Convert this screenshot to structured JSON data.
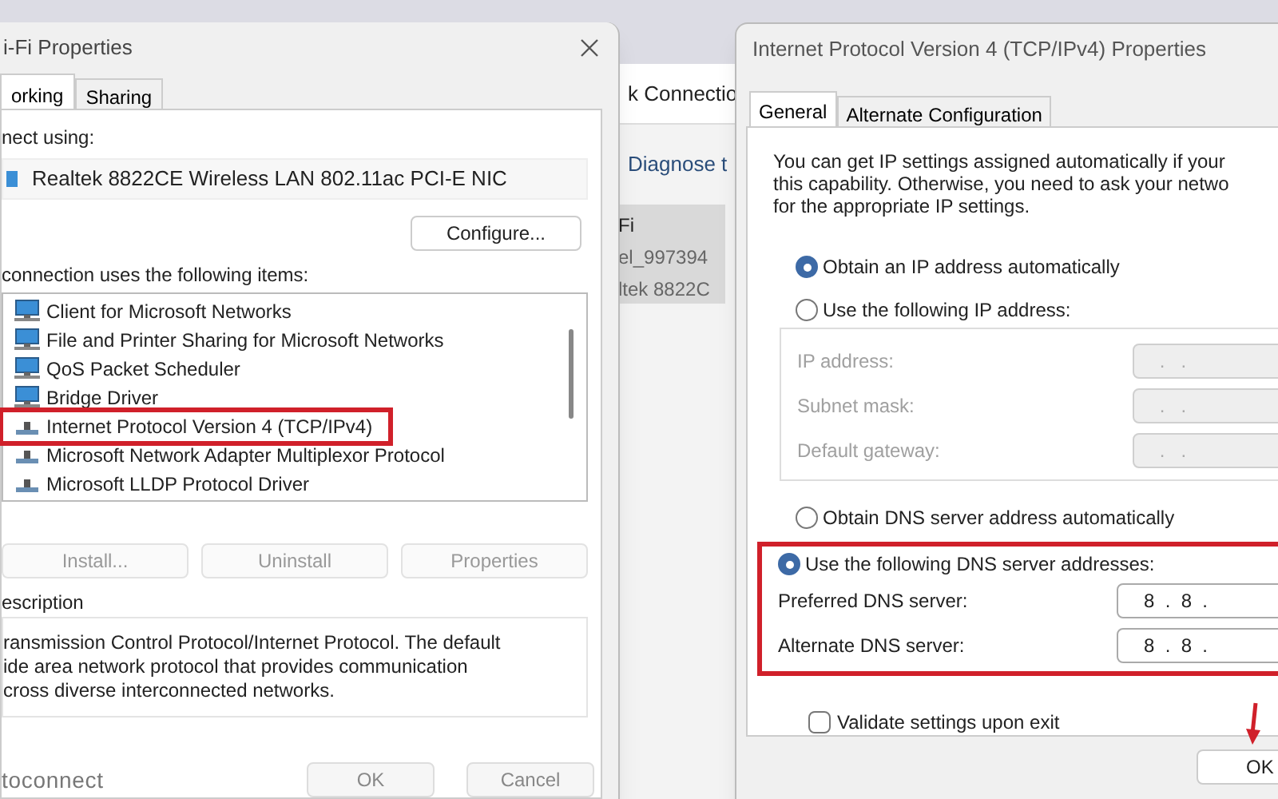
{
  "left_dialog": {
    "title": "i-Fi Properties",
    "tabs": [
      {
        "label": "orking",
        "selected": true
      },
      {
        "label": "Sharing",
        "selected": false
      }
    ],
    "connect_using_label": "nect using:",
    "adapter": "Realtek 8822CE Wireless LAN 802.11ac PCI-E NIC",
    "configure_button": "Configure...",
    "items_label": "connection uses the following items:",
    "items": [
      {
        "kind": "client",
        "label": "Client for Microsoft Networks",
        "highlighted": false
      },
      {
        "kind": "client",
        "label": "File and Printer Sharing for Microsoft Networks",
        "highlighted": false
      },
      {
        "kind": "client",
        "label": "QoS Packet Scheduler",
        "highlighted": false
      },
      {
        "kind": "client",
        "label": "Bridge Driver",
        "highlighted": false
      },
      {
        "kind": "protocol",
        "label": "Internet Protocol Version 4 (TCP/IPv4)",
        "highlighted": true
      },
      {
        "kind": "protocol",
        "label": "Microsoft Network Adapter Multiplexor Protocol",
        "highlighted": false
      },
      {
        "kind": "protocol",
        "label": "Microsoft LLDP Protocol Driver",
        "highlighted": false
      }
    ],
    "buttons": [
      {
        "label": "Install...",
        "disabled": true
      },
      {
        "label": "Uninstall",
        "disabled": true
      },
      {
        "label": "Properties",
        "disabled": true
      }
    ],
    "description_label": "escription",
    "description_lines": [
      "ransmission Control Protocol/Internet Protocol. The default",
      "ide area network protocol that provides communication",
      "cross diverse interconnected networks."
    ],
    "autoconnect": "toconnect",
    "footer_buttons": [
      "OK",
      "Cancel"
    ]
  },
  "middle_window": {
    "header": "k Connectio",
    "action": "Diagnose t",
    "lines": [
      "Fi",
      "el_997394",
      "ltek 8822C"
    ]
  },
  "right_dialog": {
    "title": "Internet Protocol Version 4 (TCP/IPv4) Properties",
    "tabs": [
      {
        "label": "General",
        "selected": true
      },
      {
        "label": "Alternate Configuration",
        "selected": false
      }
    ],
    "intro_lines": [
      "You can get IP settings assigned automatically if your",
      "this capability. Otherwise, you need to ask your netwo",
      "for the appropriate IP settings."
    ],
    "ip_options": [
      {
        "label": "Obtain an IP address automatically",
        "selected": true
      },
      {
        "label": "Use the following IP address:",
        "selected": false
      }
    ],
    "ip_fields": [
      {
        "label": "IP address:",
        "value": ".   .",
        "disabled": true
      },
      {
        "label": "Subnet mask:",
        "value": ".   .",
        "disabled": true
      },
      {
        "label": "Default gateway:",
        "value": ".   .",
        "disabled": true
      }
    ],
    "dns_options": [
      {
        "label": "Obtain DNS server address automatically",
        "selected": false
      },
      {
        "label": "Use the following DNS server addresses:",
        "selected": true
      }
    ],
    "dns_fields": [
      {
        "label": "Preferred DNS server:",
        "value": "8  .  8  .",
        "disabled": false
      },
      {
        "label": "Alternate DNS server:",
        "value": "8  .  8  .",
        "disabled": false
      }
    ],
    "dns_highlighted": true,
    "validate": {
      "label": "Validate settings upon exit",
      "checked": false
    },
    "ok_button": "OK",
    "ok_arrow": true
  }
}
